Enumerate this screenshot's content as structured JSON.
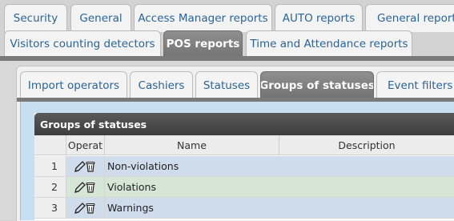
{
  "main_tabs_row1": [
    "Security",
    "General",
    "Access Manager reports",
    "AUTO reports",
    "General reports"
  ],
  "main_tabs_row2": [
    "Visitors counting detectors",
    "POS reports",
    "Time and Attendance reports"
  ],
  "active_main_tab": "POS reports",
  "sub_tabs": [
    "Import operators",
    "Cashiers",
    "Statuses",
    "Groups of statuses",
    "Event filters"
  ],
  "active_sub_tab": "Groups of statuses",
  "grid": {
    "caption": "Groups of statuses",
    "columns": [
      "",
      "Operat",
      "Name",
      "Description"
    ],
    "rows": [
      {
        "num": "1",
        "name": "Non-violations",
        "description": "",
        "color": "#cfdcec"
      },
      {
        "num": "2",
        "name": "Violations",
        "description": "",
        "color": "#d6e6d6"
      },
      {
        "num": "3",
        "name": "Warnings",
        "description": "",
        "color": "#cfdcec"
      }
    ],
    "row_icons": [
      "edit-pencil-icon",
      "delete-trash-icon"
    ]
  },
  "colors": {
    "link": "#2a6496",
    "active_tab": "#7e7e7e",
    "caption_bar": "#474747"
  }
}
